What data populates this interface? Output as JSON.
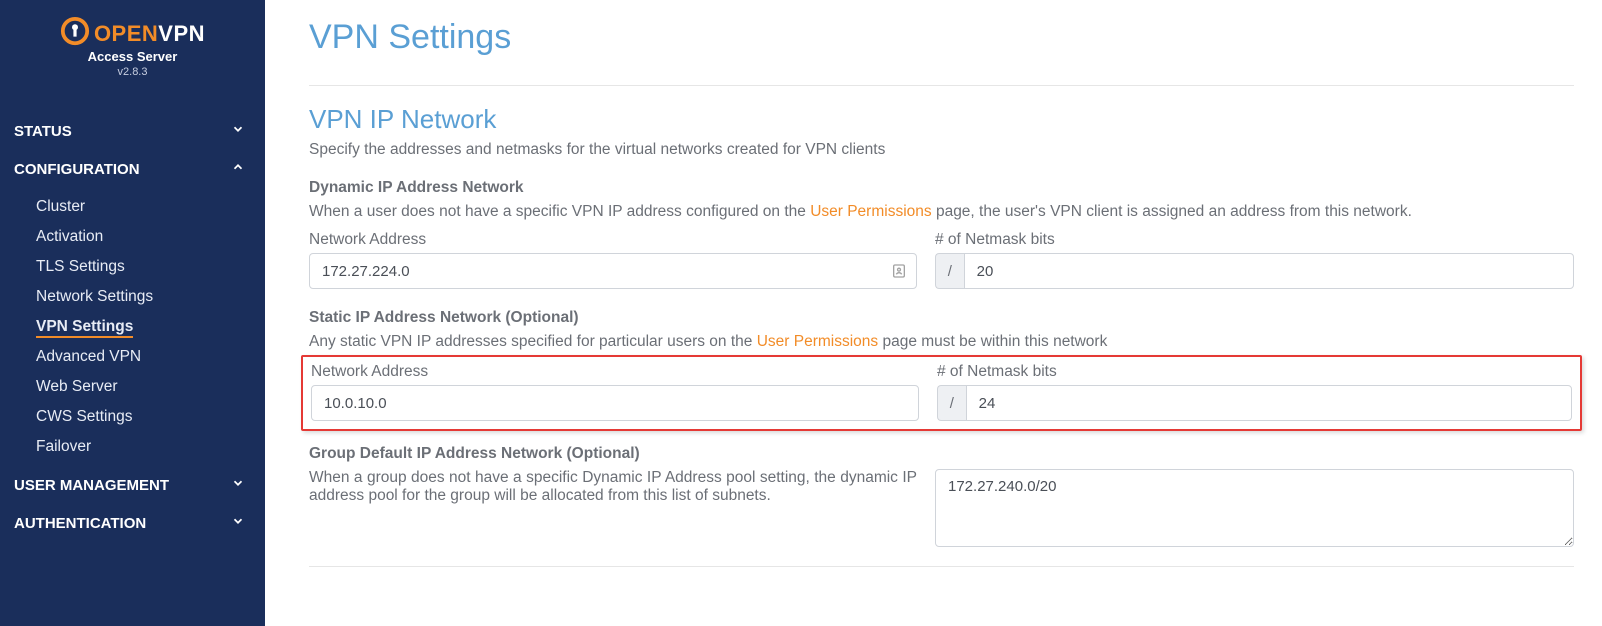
{
  "brand": {
    "open": "OPEN",
    "vpn": "VPN",
    "sub": "Access Server",
    "version": "v2.8.3"
  },
  "nav": {
    "status": {
      "label": "STATUS"
    },
    "configuration": {
      "label": "CONFIGURATION",
      "items": {
        "cluster": "Cluster",
        "activation": "Activation",
        "tls": "TLS Settings",
        "network": "Network Settings",
        "vpn": "VPN Settings",
        "advanced": "Advanced VPN",
        "web": "Web Server",
        "cws": "CWS Settings",
        "failover": "Failover"
      }
    },
    "usermgmt": {
      "label": "USER  MANAGEMENT"
    },
    "auth": {
      "label": "AUTHENTICATION"
    }
  },
  "page": {
    "title": "VPN Settings",
    "ip_network": {
      "title": "VPN IP Network",
      "desc": "Specify the addresses and netmasks for the virtual networks created for VPN clients"
    },
    "dynamic": {
      "title": "Dynamic IP Address Network",
      "desc_pre": "When a user does not have a specific VPN IP address configured on the ",
      "desc_link": "User Permissions",
      "desc_post": " page, the user's VPN client is assigned an address from this network.",
      "addr_label": "Network Address",
      "addr_value": "172.27.224.0",
      "mask_label": "# of Netmask bits",
      "mask_value": "20",
      "slash": "/"
    },
    "static": {
      "title": "Static IP Address Network (Optional)",
      "desc_pre": "Any static VPN IP addresses specified for particular users on the ",
      "desc_link": "User Permissions",
      "desc_post": " page must be within this network",
      "addr_label": "Network Address",
      "addr_value": "10.0.10.0",
      "mask_label": "# of Netmask bits",
      "mask_value": "24",
      "slash": "/"
    },
    "group": {
      "title": "Group Default IP Address Network (Optional)",
      "desc": "When a group does not have a specific Dynamic IP Address pool setting, the dynamic IP address pool for the group will be allocated from this list of subnets.",
      "value": "172.27.240.0/20"
    }
  }
}
